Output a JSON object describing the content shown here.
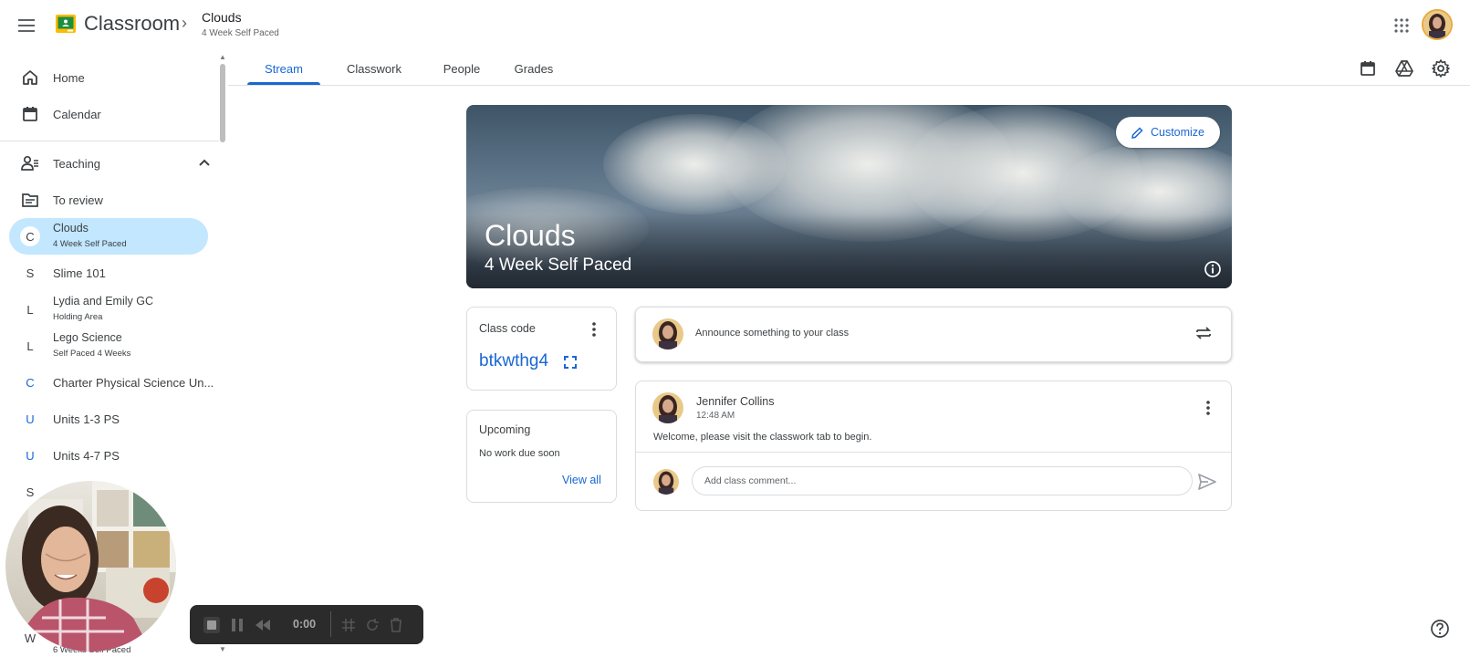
{
  "app": {
    "name": "Classroom"
  },
  "breadcrumb": {
    "class_name": "Clouds",
    "section": "4 Week Self Paced"
  },
  "sidebar": {
    "home": "Home",
    "calendar": "Calendar",
    "teaching": "Teaching",
    "to_review": "To review",
    "classes": [
      {
        "letter": "C",
        "name": "Clouds",
        "section": "4 Week Self Paced",
        "active": true
      },
      {
        "letter": "S",
        "name": "Slime 101",
        "section": ""
      },
      {
        "letter": "L",
        "name": "Lydia and Emily GC",
        "section": "Holding Area"
      },
      {
        "letter": "L",
        "name": "Lego Science",
        "section": "Self Paced 4 Weeks"
      },
      {
        "letter": "C",
        "name": "Charter Physical Science Un...",
        "section": ""
      },
      {
        "letter": "U",
        "name": "Units 1-3 PS",
        "section": ""
      },
      {
        "letter": "U",
        "name": "Units 4-7 PS",
        "section": ""
      },
      {
        "letter": "S",
        "name": "",
        "section": ""
      },
      {
        "letter": "W",
        "name": "",
        "section": "6 Weeks Self Paced"
      }
    ]
  },
  "tabs": [
    "Stream",
    "Classwork",
    "People",
    "Grades"
  ],
  "banner": {
    "title": "Clouds",
    "subtitle": "4 Week Self Paced",
    "customize": "Customize"
  },
  "class_code": {
    "label": "Class code",
    "code": "btkwthg4"
  },
  "upcoming": {
    "title": "Upcoming",
    "text": "No work due soon",
    "view_all": "View all"
  },
  "announce": {
    "placeholder": "Announce something to your class"
  },
  "post": {
    "author": "Jennifer Collins",
    "time": "12:48 AM",
    "text": "Welcome, please visit the classwork tab to begin.",
    "comment_placeholder": "Add class comment..."
  },
  "recorder": {
    "time": "0:00"
  },
  "colors": {
    "accent": "#1967d2",
    "active_bg": "#c2e7ff",
    "logo_green": "#1e8e3e",
    "logo_yellow": "#fbbc04"
  }
}
